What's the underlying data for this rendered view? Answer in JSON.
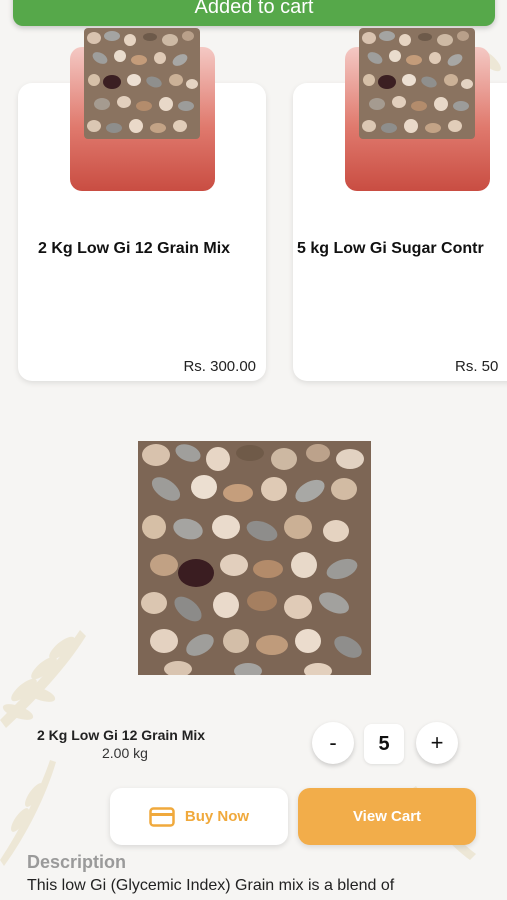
{
  "toast": {
    "message": "Added to cart"
  },
  "related_products": [
    {
      "title": "2 Kg Low Gi 12 Grain Mix",
      "price": "Rs. 300.00"
    },
    {
      "title": "5 kg Low Gi Sugar Contr",
      "price": "Rs. 50"
    }
  ],
  "product": {
    "name": "2 Kg Low Gi 12 Grain Mix",
    "weight": "2.00 kg",
    "quantity": "5",
    "minus_label": "-",
    "plus_label": "+"
  },
  "actions": {
    "buy_now": "Buy Now",
    "view_cart": "View Cart"
  },
  "description": {
    "heading": "Description",
    "text": "This low Gi (Glycemic Index) Grain mix is a blend of"
  },
  "colors": {
    "toast": "#56a84a",
    "accent": "#f2ad4a",
    "card_gradient_bottom": "#c94d42"
  },
  "icons": {
    "buy_now": "card-icon"
  }
}
